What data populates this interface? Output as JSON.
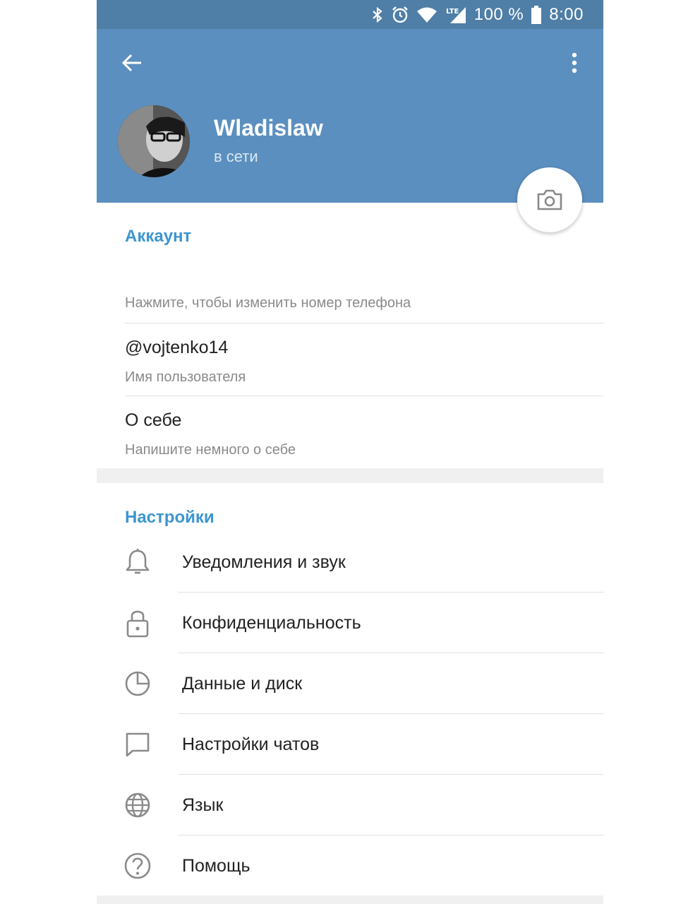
{
  "status_bar": {
    "battery": "100 %",
    "time": "8:00",
    "network": "LTE"
  },
  "profile": {
    "name": "Wladislaw",
    "status": "в сети"
  },
  "account": {
    "title": "Аккаунт",
    "phone_hint": "Нажмите, чтобы изменить номер телефона",
    "username_value": "@vojtenko14",
    "username_label": "Имя пользователя",
    "bio_value": "О себе",
    "bio_hint": "Напишите немного о себе"
  },
  "settings": {
    "title": "Настройки",
    "items": [
      {
        "label": "Уведомления и звук",
        "icon": "bell-icon"
      },
      {
        "label": "Конфиденциальность",
        "icon": "lock-icon"
      },
      {
        "label": "Данные и диск",
        "icon": "pie-chart-icon"
      },
      {
        "label": "Настройки чатов",
        "icon": "chat-bubble-icon"
      },
      {
        "label": "Язык",
        "icon": "globe-icon"
      },
      {
        "label": "Помощь",
        "icon": "help-icon"
      }
    ]
  },
  "colors": {
    "header": "#5b8fbf",
    "status_bar": "#4f7ea6",
    "accent": "#3d95cf"
  }
}
